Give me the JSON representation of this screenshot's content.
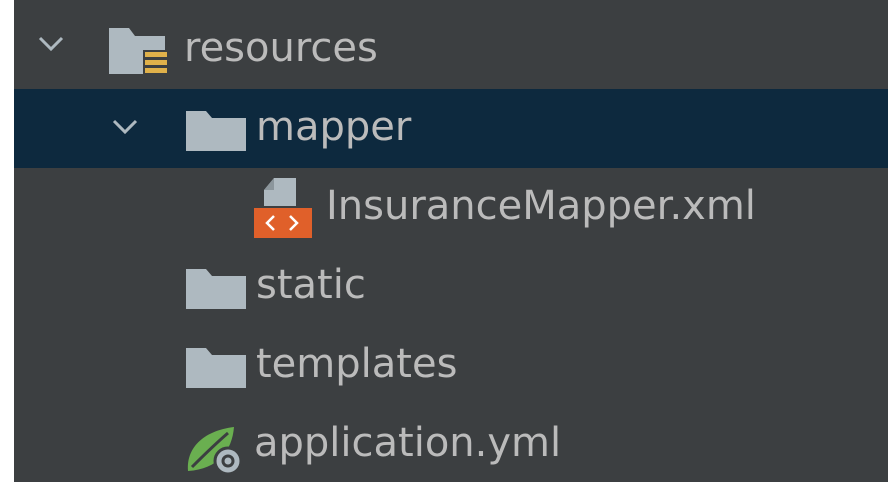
{
  "project_tree": {
    "items": [
      {
        "label": "resources",
        "icon": "resources-folder-icon",
        "expanded": true
      },
      {
        "label": "mapper",
        "icon": "folder-icon",
        "expanded": true,
        "selected": true
      },
      {
        "label": "InsuranceMapper.xml",
        "icon": "xml-file-icon"
      },
      {
        "label": "static",
        "icon": "folder-icon"
      },
      {
        "label": "templates",
        "icon": "folder-icon"
      },
      {
        "label": "application.yml",
        "icon": "spring-config-file-icon"
      }
    ]
  },
  "colors": {
    "panel_background": "#3c3f41",
    "selected_row": "#0d293e",
    "text": "#bbbbbb",
    "folder_icon": "#aeb9c0",
    "xml_badge": "#e0602a",
    "spring_leaf": "#6aaf50"
  }
}
